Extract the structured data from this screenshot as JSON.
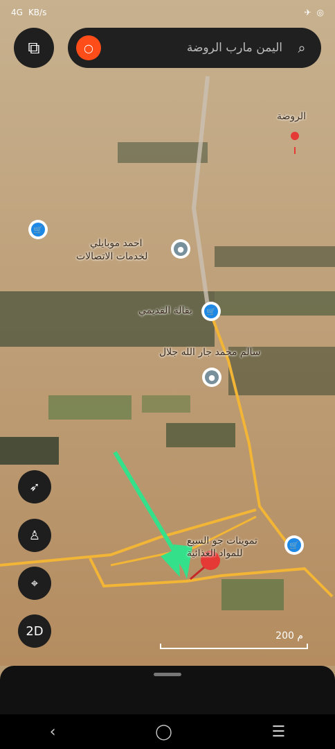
{
  "status_bar": {
    "left": [
      "4G",
      "KB/s"
    ],
    "right": [
      "Telegram",
      "WhatsApp"
    ]
  },
  "search": {
    "placeholder": "اليمن مارب الروضة"
  },
  "map_labels": {
    "area": "الروضة",
    "poi_1": "احمد موبايلي",
    "poi_2": "لخدمات الاتصالات",
    "shop_1": "بقالة القديمي",
    "person": "سالم محمد جار الله جلال",
    "shop_2": "تموينات جو السبع",
    "shop_2_line2": "للمواد الغذائية"
  },
  "controls": {
    "mode_label": "2D"
  },
  "scale": {
    "text": "200 م"
  },
  "colors": {
    "road": "#f2b535",
    "arrow": "#34e08a",
    "pin": "#e53935"
  }
}
